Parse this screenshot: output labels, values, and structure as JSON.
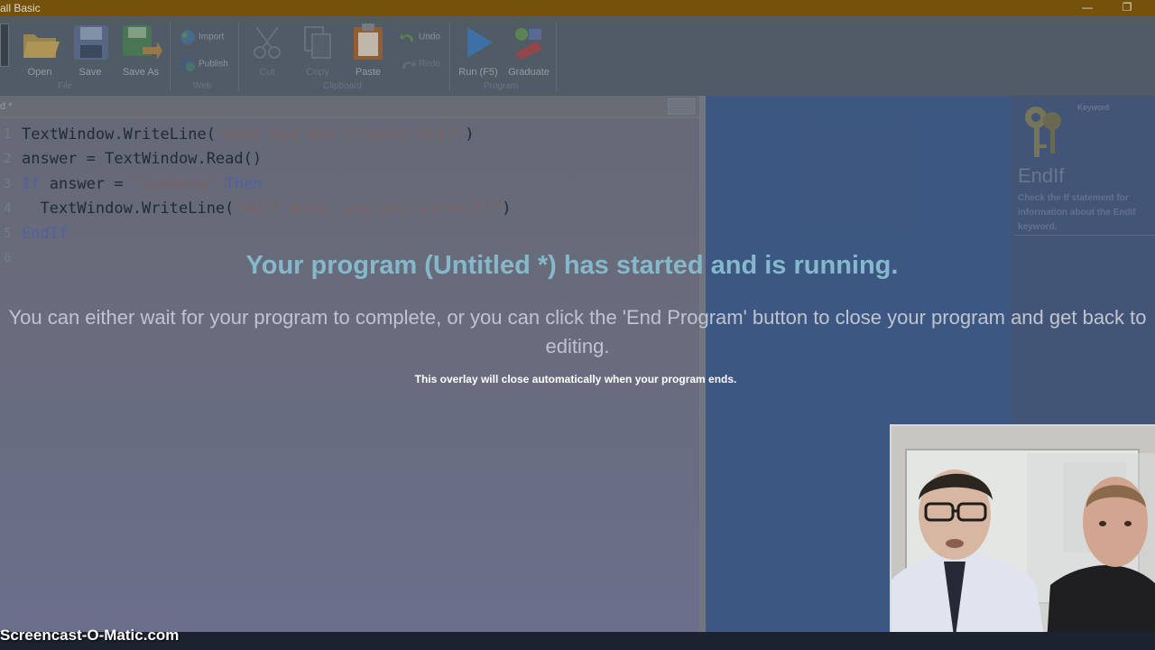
{
  "window": {
    "title": "all Basic"
  },
  "ribbon": {
    "open": "Open",
    "save": "Save",
    "save_as": "Save As",
    "import": "Import",
    "publish": "Publish",
    "cut": "Cut",
    "copy": "Copy",
    "paste": "Paste",
    "undo": "Undo",
    "redo": "Redo",
    "run": "Run (F5)",
    "graduate": "Graduate",
    "group_file": "File",
    "group_web": "Web",
    "group_clipboard": "Clipboard",
    "group_program": "Program"
  },
  "editor": {
    "tab_title": "d *",
    "lines": [
      {
        "num": "1",
        "parts": [
          {
            "t": "TextWindow.WriteLine(",
            "c": "n"
          },
          {
            "t": "\"What did the Titanic hit?\"",
            "c": "s"
          },
          {
            "t": ")",
            "c": "n"
          }
        ]
      },
      {
        "num": "2",
        "parts": [
          {
            "t": "answer = TextWindow.Read()",
            "c": "n"
          }
        ]
      },
      {
        "num": "3",
        "parts": [
          {
            "t": "If",
            "c": "k"
          },
          {
            "t": " answer = ",
            "c": "n"
          },
          {
            "t": "\"iceberg\"",
            "c": "s"
          },
          {
            "t": " ",
            "c": "n"
          },
          {
            "t": "Then",
            "c": "k"
          }
        ]
      },
      {
        "num": "4",
        "parts": [
          {
            "t": "  TextWindow.WriteLine(",
            "c": "n"
          },
          {
            "t": "\"Well done, you are correct!\"",
            "c": "s"
          },
          {
            "t": ")",
            "c": "n"
          }
        ]
      },
      {
        "num": "5",
        "parts": [
          {
            "t": "EndIf",
            "c": "k"
          }
        ]
      },
      {
        "num": "6",
        "parts": []
      }
    ]
  },
  "help": {
    "label": "Keyword",
    "keyword": "EndIf",
    "description": "Check the If statement for information about the EndIf keyword."
  },
  "overlay": {
    "title": "Your program (Untitled *) has started and is running.",
    "message": "You can either wait for your program to complete, or you can click the 'End Program' button to close your program and get back to editing.",
    "note": "This overlay will close automatically when your program ends."
  },
  "watermark": "Screencast-O-Matic.com",
  "colors": {
    "titlebar": "#7a5408",
    "overlay_title": "#86b8cc",
    "panel_blue": "#3e5a84"
  }
}
